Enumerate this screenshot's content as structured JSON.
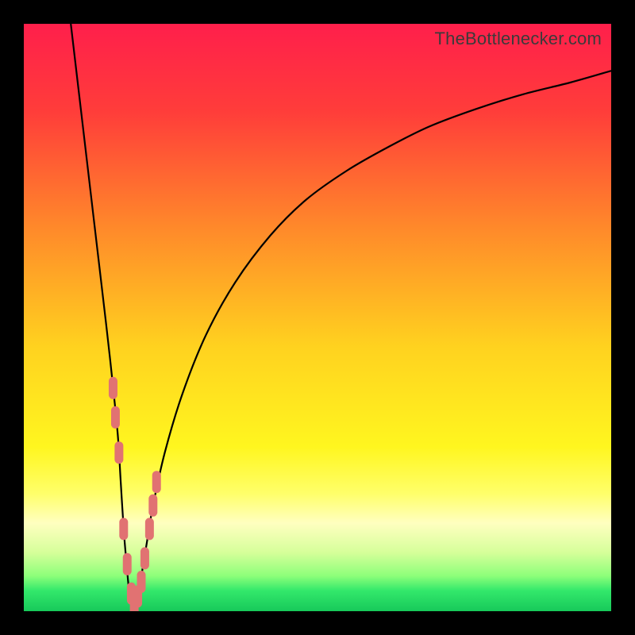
{
  "watermark": "TheBottlenecker.com",
  "chart_data": {
    "type": "line",
    "title": "",
    "xlabel": "",
    "ylabel": "",
    "xlim": [
      0,
      100
    ],
    "ylim": [
      0,
      100
    ],
    "series": [
      {
        "name": "bottleneck-curve",
        "x": [
          8,
          10,
          12,
          14,
          15,
          16,
          16.5,
          17,
          17.5,
          18,
          18.8,
          19.5,
          21,
          22,
          24,
          27,
          31,
          36,
          42,
          48,
          55,
          62,
          69,
          77,
          85,
          93,
          100
        ],
        "y": [
          100,
          83,
          66,
          49,
          40,
          30,
          22,
          14,
          8,
          3,
          0,
          3,
          12,
          18,
          27,
          37,
          47,
          56,
          64,
          70,
          75,
          79,
          82.5,
          85.5,
          88,
          90,
          92
        ]
      }
    ],
    "markers": {
      "name": "highlighted-points",
      "color": "#e17272",
      "x": [
        15.2,
        15.6,
        16.2,
        17.0,
        17.6,
        18.3,
        18.8,
        19.4,
        20.0,
        20.6,
        21.4,
        22.0,
        22.6
      ],
      "y": [
        38,
        33,
        27,
        14,
        8,
        3,
        0,
        2.5,
        5,
        9,
        14,
        18,
        22
      ]
    },
    "gradient_stops": [
      {
        "offset": 0.0,
        "color": "#ff1f4b"
      },
      {
        "offset": 0.15,
        "color": "#ff3d3a"
      },
      {
        "offset": 0.35,
        "color": "#ff8a2a"
      },
      {
        "offset": 0.55,
        "color": "#ffd21f"
      },
      {
        "offset": 0.72,
        "color": "#fff61f"
      },
      {
        "offset": 0.8,
        "color": "#ffff6a"
      },
      {
        "offset": 0.85,
        "color": "#ffffc0"
      },
      {
        "offset": 0.9,
        "color": "#d6ff9a"
      },
      {
        "offset": 0.94,
        "color": "#8dff7a"
      },
      {
        "offset": 0.965,
        "color": "#33e86b"
      },
      {
        "offset": 1.0,
        "color": "#17c95a"
      }
    ]
  }
}
